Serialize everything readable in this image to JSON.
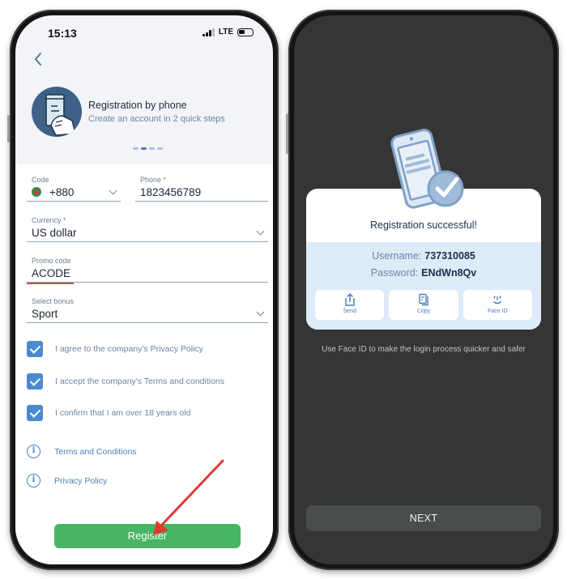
{
  "left_screen": {
    "status_bar": {
      "time": "15:13",
      "network": "LTE",
      "battery_level": 0.45
    },
    "back_icon": "chevron-left-icon",
    "hero": {
      "title": "Registration by phone",
      "subtitle": "Create an account in 2 quick steps",
      "icon": "phone-in-hand-icon"
    },
    "steps": {
      "total": 4,
      "current": 2
    },
    "form": {
      "code": {
        "label": "Code",
        "value": "+880",
        "flag": "bangladesh-flag-icon"
      },
      "phone": {
        "label": "Phone *",
        "value": "1823456789"
      },
      "currency": {
        "label": "Currency *",
        "value": "US dollar"
      },
      "promo": {
        "label": "Promo code",
        "value": "ACODE"
      },
      "bonus": {
        "label": "Select bonus",
        "value": "Sport"
      }
    },
    "checkboxes": [
      {
        "label": "I agree to the company's Privacy Policy",
        "checked": true
      },
      {
        "label": "I accept the company's Terms and conditions",
        "checked": true
      },
      {
        "label": "I confirm that I am over 18 years old",
        "checked": true
      }
    ],
    "links": [
      {
        "label": "Terms and Conditions",
        "icon": "info-icon"
      },
      {
        "label": "Privacy Policy",
        "icon": "info-icon"
      }
    ],
    "register_label": "Register",
    "colors": {
      "accent": "#4a8ad1",
      "register": "#48b564",
      "annotation_arrow": "#e03a33"
    }
  },
  "right_screen": {
    "illustration": "phone-checkmark-icon",
    "title": "Registration successful!",
    "credentials": {
      "username_label": "Username:",
      "username": "737310085",
      "password_label": "Password:",
      "password": "ENdWn8Qv"
    },
    "actions": [
      {
        "label": "Send",
        "icon": "share-icon"
      },
      {
        "label": "Copy",
        "icon": "copy-icon"
      },
      {
        "label": "Face ID",
        "icon": "face-id-icon"
      }
    ],
    "hint": "Use Face ID to make the login process quicker and safer",
    "next_label": "NEXT"
  }
}
